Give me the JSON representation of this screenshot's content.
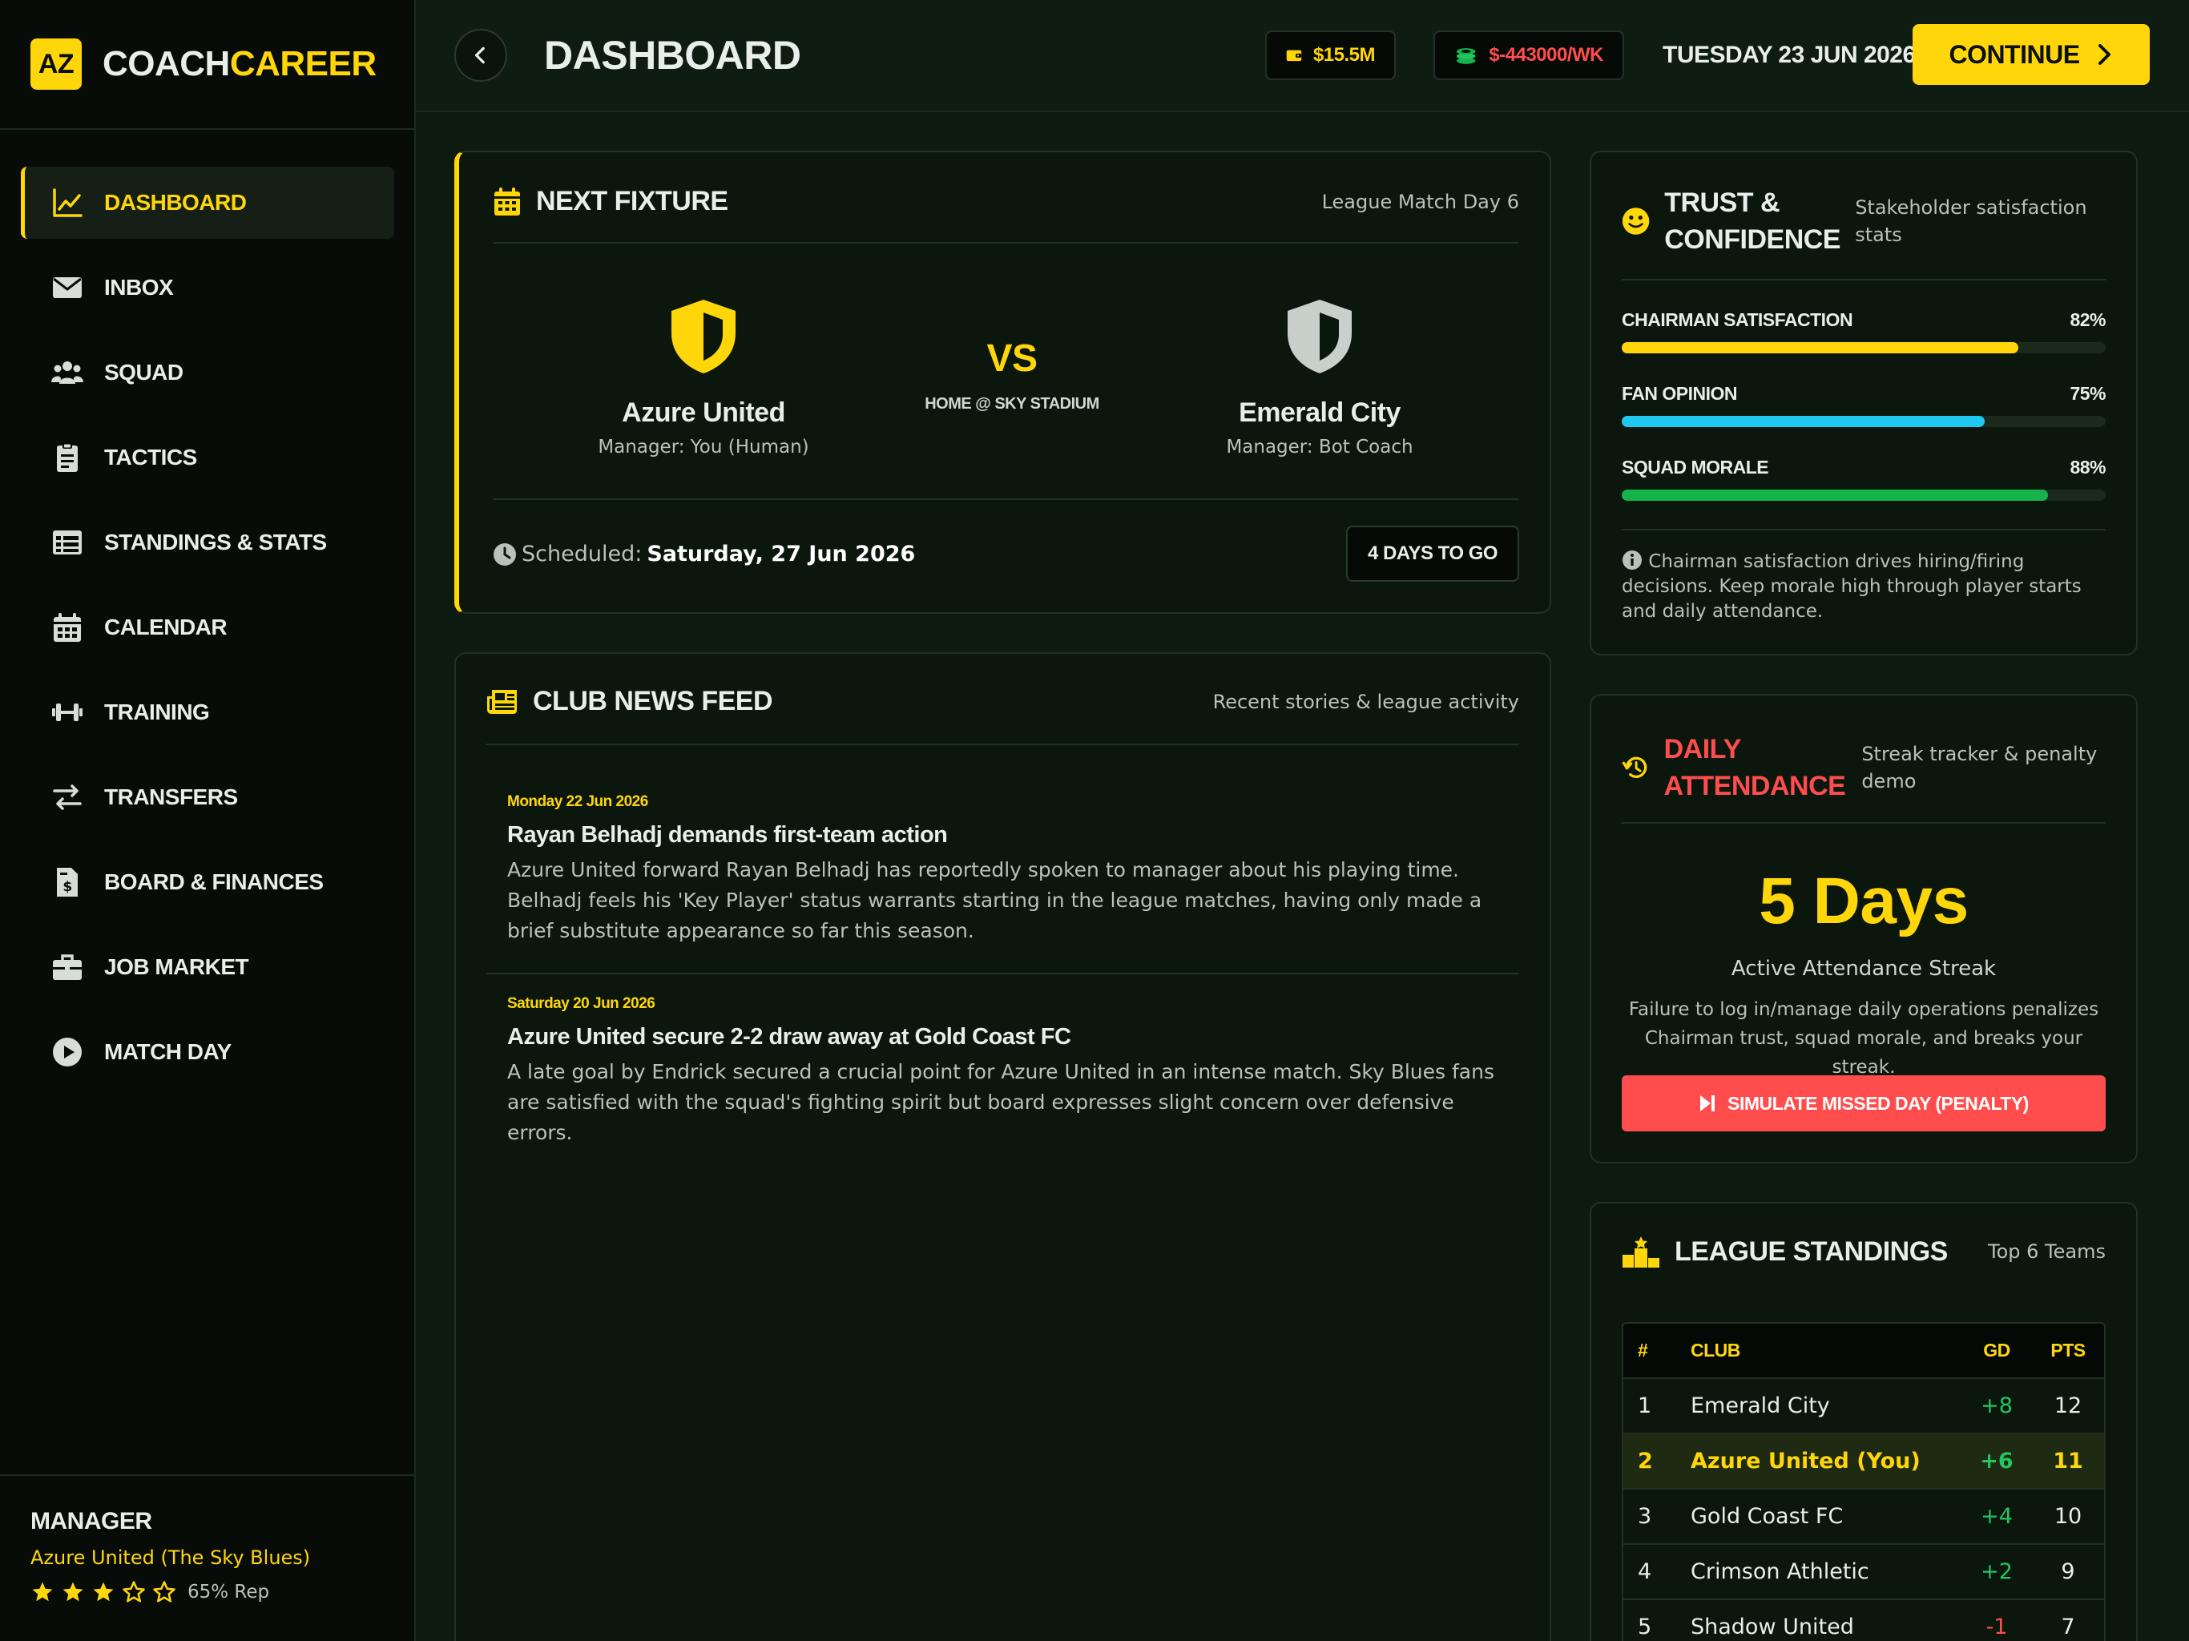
{
  "brand": {
    "badge": "AZ",
    "name_a": "COACH",
    "name_b": "CAREER"
  },
  "nav": [
    {
      "label": "DASHBOARD",
      "icon": "chart-line-icon",
      "active": true
    },
    {
      "label": "INBOX",
      "icon": "envelope-icon"
    },
    {
      "label": "SQUAD",
      "icon": "users-icon"
    },
    {
      "label": "TACTICS",
      "icon": "clipboard-icon"
    },
    {
      "label": "STANDINGS & STATS",
      "icon": "table-icon"
    },
    {
      "label": "CALENDAR",
      "icon": "calendar-icon"
    },
    {
      "label": "TRAINING",
      "icon": "dumbbell-icon"
    },
    {
      "label": "TRANSFERS",
      "icon": "arrows-exchange-icon"
    },
    {
      "label": "BOARD & FINANCES",
      "icon": "file-invoice-dollar-icon"
    },
    {
      "label": "JOB MARKET",
      "icon": "briefcase-icon"
    },
    {
      "label": "MATCH DAY",
      "icon": "play-circle-icon"
    }
  ],
  "manager": {
    "role": "MANAGER",
    "club": "Azure United (The Sky Blues)",
    "stars": 3,
    "max_stars": 5,
    "rep": "65% Rep"
  },
  "header": {
    "title": "DASHBOARD",
    "funds": "$15.5M",
    "wage": "$-443000/WK",
    "date": "TUESDAY 23 JUN 2026",
    "continue": "CONTINUE"
  },
  "fixture": {
    "title": "NEXT FIXTURE",
    "matchday": "League Match Day 6",
    "home": {
      "name": "Azure United",
      "manager": "Manager: You (Human)"
    },
    "vs": "VS",
    "venue": "HOME @ SKY STADIUM",
    "away": {
      "name": "Emerald City",
      "manager": "Manager: Bot Coach"
    },
    "scheduled_label": "Scheduled:",
    "scheduled_date": "Saturday, 27 Jun 2026",
    "countdown": "4 DAYS TO GO"
  },
  "news": {
    "title": "CLUB NEWS FEED",
    "subtitle": "Recent stories & league activity",
    "items": [
      {
        "date": "Monday 22 Jun 2026",
        "headline": "Rayan Belhadj demands first-team action",
        "body": "Azure United forward Rayan Belhadj has reportedly spoken to manager about his playing time. Belhadj feels his 'Key Player' status warrants starting in the league matches, having only made a brief substitute appearance so far this season."
      },
      {
        "date": "Saturday 20 Jun 2026",
        "headline": "Azure United secure 2-2 draw away at Gold Coast FC",
        "body": "A late goal by Endrick secured a crucial point for Azure United in an intense match. Sky Blues fans are satisfied with the squad's fighting spirit but board expresses slight concern over defensive errors."
      }
    ]
  },
  "trust": {
    "title_1": "TRUST &",
    "title_2": "CONFIDENCE",
    "subtitle": "Stakeholder satisfaction stats",
    "meters": [
      {
        "label": "CHAIRMAN SATISFACTION",
        "value": "82%",
        "pct": 82,
        "color": "#ffd60a"
      },
      {
        "label": "FAN OPINION",
        "value": "75%",
        "pct": 75,
        "color": "#1ec8f0"
      },
      {
        "label": "SQUAD MORALE",
        "value": "88%",
        "pct": 88,
        "color": "#16b34a"
      }
    ],
    "note": "Chairman satisfaction drives hiring/firing decisions. Keep morale high through player starts and daily attendance."
  },
  "attendance": {
    "title_1": "DAILY",
    "title_2": "ATTENDANCE",
    "subtitle": "Streak tracker & penalty demo",
    "streak": "5 Days",
    "streak_label": "Active Attendance Streak",
    "desc": "Failure to log in/manage daily operations penalizes Chairman trust, squad morale, and breaks your streak.",
    "button": "SIMULATE MISSED DAY (PENALTY)"
  },
  "standings": {
    "title": "LEAGUE STANDINGS",
    "subtitle": "Top 6 Teams",
    "columns": [
      "#",
      "CLUB",
      "GD",
      "PTS"
    ],
    "rows": [
      {
        "pos": "1",
        "club": "Emerald City",
        "gd": "+8",
        "pts": "12"
      },
      {
        "pos": "2",
        "club": "Azure United (You)",
        "gd": "+6",
        "pts": "11",
        "me": true
      },
      {
        "pos": "3",
        "club": "Gold Coast FC",
        "gd": "+4",
        "pts": "10"
      },
      {
        "pos": "4",
        "club": "Crimson Athletic",
        "gd": "+2",
        "pts": "9"
      },
      {
        "pos": "5",
        "club": "Shadow United",
        "gd": "-1",
        "pts": "7"
      }
    ]
  },
  "colors": {
    "accent": "#ffd60a",
    "danger": "#ff4d4d",
    "positive": "#22c55e",
    "bg": "#0d1a10"
  }
}
